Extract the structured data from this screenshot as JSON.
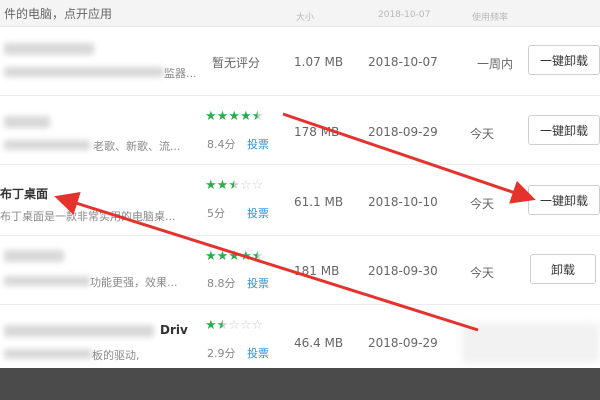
{
  "header": {
    "hint": "件的电脑，点开应用",
    "col_size": "大小",
    "col_date": "2018-10-07",
    "col_freq": "使用频率"
  },
  "rows": [
    {
      "name": "",
      "desc": "监器...",
      "score_text": "暂无评分",
      "vote": "",
      "size": "1.07 MB",
      "date": "2018-10-07",
      "freq": "一周内",
      "button": "一键卸载"
    },
    {
      "name": "",
      "desc": "老歌、新歌、流...",
      "rating": 4.5,
      "score_text": "8.4分",
      "vote": "投票",
      "size": "178 MB",
      "date": "2018-09-29",
      "freq": "今天",
      "button": "一键卸载"
    },
    {
      "name": "布丁桌面",
      "desc": "布丁桌面是一款非常实用的电脑桌...",
      "rating": 2.5,
      "score_text": "5分",
      "vote": "投票",
      "size": "61.1 MB",
      "date": "2018-10-10",
      "freq": "今天",
      "button": "一键卸载"
    },
    {
      "name": "",
      "desc": "功能更强，效果...",
      "rating": 4.5,
      "score_text": "8.8分",
      "vote": "投票",
      "size": "181 MB",
      "date": "2018-09-30",
      "freq": "今天",
      "button": "卸载"
    },
    {
      "name": "Driv",
      "desc": "板的驱动,",
      "rating": 1.5,
      "score_text": "2.9分",
      "vote": "投票",
      "size": "46.4 MB",
      "date": "2018-09-29",
      "freq": "",
      "button": ""
    }
  ],
  "annotation": {
    "arrow_color": "#e5322d"
  }
}
